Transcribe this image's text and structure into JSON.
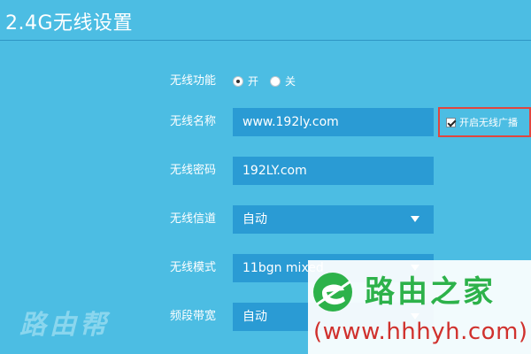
{
  "page": {
    "title": "2.4G无线设置"
  },
  "wireless_function": {
    "label": "无线功能",
    "options": [
      {
        "label": "开",
        "checked": true
      },
      {
        "label": "关",
        "checked": false
      }
    ]
  },
  "ssid": {
    "label": "无线名称",
    "value": "www.192ly.com",
    "broadcast_label": "开启无线广播",
    "broadcast_checked": true
  },
  "password": {
    "label": "无线密码",
    "value": "192LY.com"
  },
  "channel": {
    "label": "无线信道",
    "value": "自动"
  },
  "mode": {
    "label": "无线模式",
    "value": "11bgn mixed"
  },
  "bandwidth": {
    "label": "频段带宽",
    "value": "自动"
  },
  "watermarks": {
    "left_text": "路由帮",
    "right_name": "路由之家",
    "right_url": "(www.hhhyh.com)"
  },
  "colors": {
    "background": "#4cbde3",
    "field": "#2a9bd4",
    "highlight": "#e0463f",
    "watermark_green": "#2db24a",
    "watermark_red": "#d0312d"
  }
}
